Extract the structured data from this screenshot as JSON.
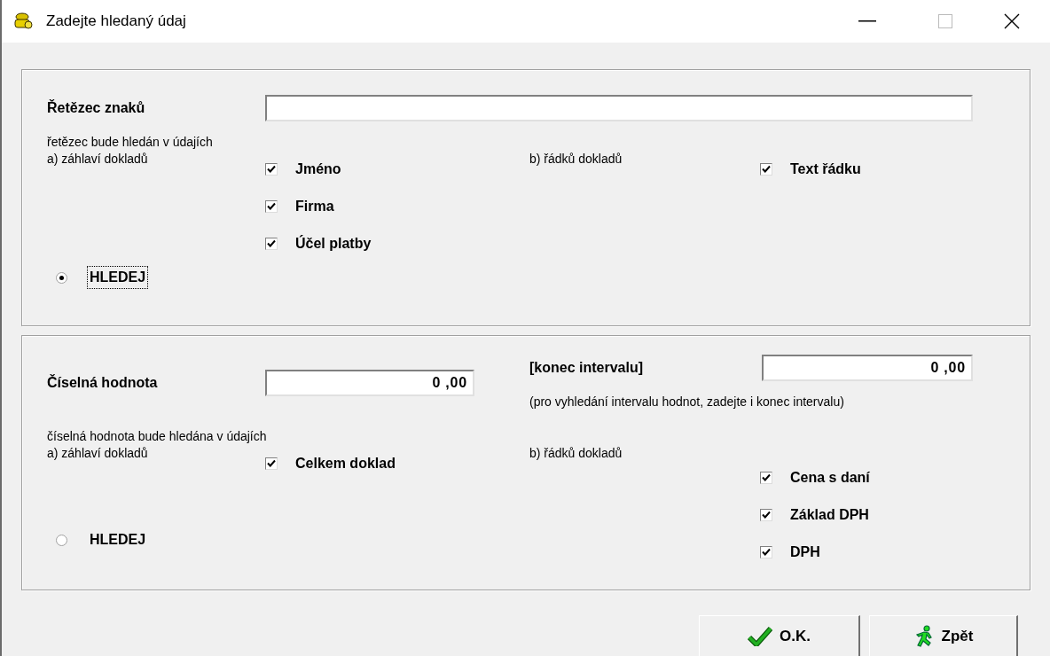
{
  "window": {
    "title": "Zadejte hledaný údaj"
  },
  "text_search": {
    "label": "Řetězec znaků",
    "note": "řetězec bude hledán v údajích",
    "header_label": "a) záhlaví dokladů",
    "rows_label": "b) řádků dokladů",
    "header_fields": [
      {
        "label": "Jméno",
        "checked": true
      },
      {
        "label": "Firma",
        "checked": true
      },
      {
        "label": "Účel platby",
        "checked": true
      }
    ],
    "row_fields": [
      {
        "label": "Text řádku",
        "checked": true
      }
    ],
    "option": {
      "label": "HLEDEJ",
      "selected": true
    }
  },
  "number_search": {
    "label": "Číselná hodnota",
    "value": "0 ,00",
    "end_label": "[konec intervalu]",
    "end_value": "0 ,00",
    "interval_note": "(pro vyhledání intervalu hodnot, zadejte i konec intervalu)",
    "note": "číselná hodnota bude hledána v údajích",
    "header_label": "a) záhlaví dokladů",
    "rows_label": "b) řádků dokladů",
    "header_fields": [
      {
        "label": "Celkem doklad",
        "checked": true
      }
    ],
    "row_fields": [
      {
        "label": "Cena s daní",
        "checked": true
      },
      {
        "label": "Základ DPH",
        "checked": true
      },
      {
        "label": "DPH",
        "checked": true
      }
    ],
    "option": {
      "label": "HLEDEJ",
      "selected": false
    }
  },
  "buttons": [
    {
      "label": "O.K.",
      "kind": "ok"
    },
    {
      "label": "Zpět",
      "kind": "back"
    }
  ]
}
